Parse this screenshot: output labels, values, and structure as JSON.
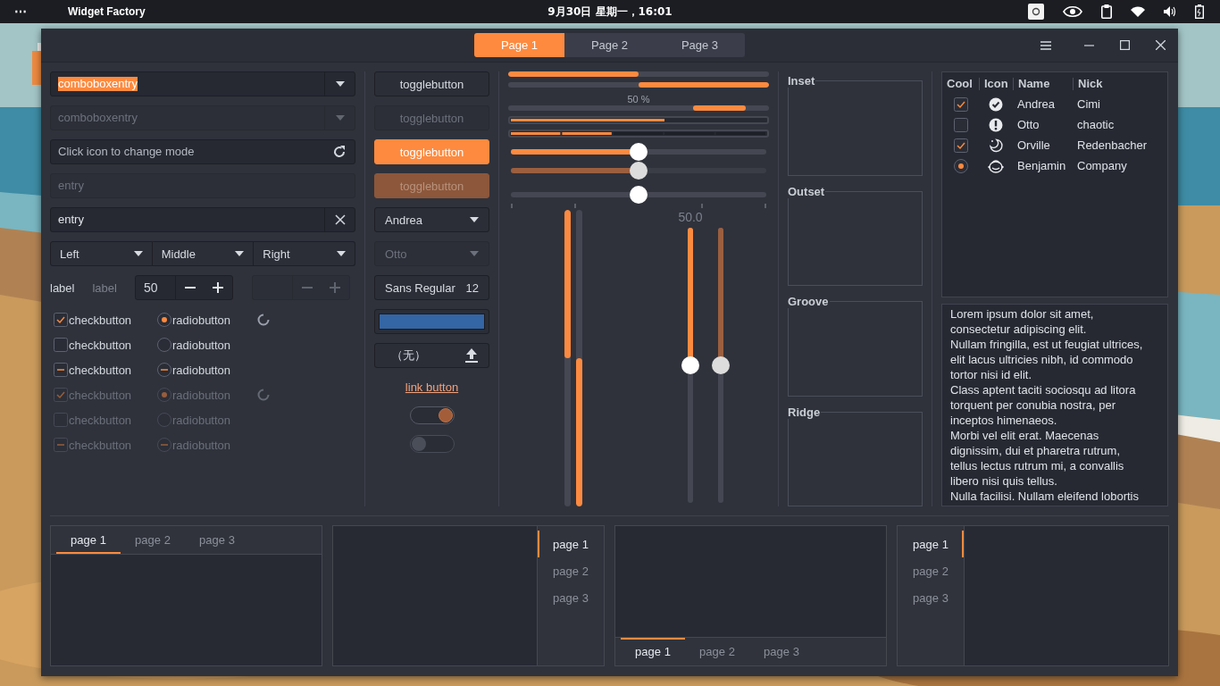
{
  "topbar": {
    "menu": "⋯",
    "app": "Widget Factory",
    "clock": "9月30日 星期一，16:01"
  },
  "header": {
    "tabs": [
      {
        "label": "Page 1",
        "selected": true
      },
      {
        "label": "Page 2",
        "selected": false
      },
      {
        "label": "Page 3",
        "selected": false
      }
    ]
  },
  "combo_entries": [
    {
      "value": "comboboxentry",
      "text_selected": true,
      "disabled": false
    },
    {
      "value": "comboboxentry",
      "text_selected": false,
      "disabled": true
    }
  ],
  "entries": [
    {
      "kind": "mode",
      "placeholder": "Click icon to change mode",
      "disabled": false
    },
    {
      "kind": "plain",
      "value": "entry",
      "disabled": true
    },
    {
      "kind": "clear",
      "value": "entry",
      "disabled": false
    }
  ],
  "linked_combos": [
    {
      "label": "Left"
    },
    {
      "label": "Middle"
    },
    {
      "label": "Right"
    }
  ],
  "labels": [
    {
      "text": "label",
      "disabled": false
    },
    {
      "text": "label",
      "disabled": true
    }
  ],
  "spinbuttons": [
    {
      "value": "50",
      "disabled": false
    },
    {
      "disabled": true
    }
  ],
  "check_rows": [
    {
      "check": {
        "label": "checkbutton",
        "checked": true,
        "inconsistent": false
      },
      "radio": {
        "label": "radiobutton",
        "selected": true,
        "inconsistent": false
      },
      "spinner": true,
      "disabled": false
    },
    {
      "check": {
        "label": "checkbutton",
        "checked": false,
        "inconsistent": false
      },
      "radio": {
        "label": "radiobutton",
        "selected": false,
        "inconsistent": false
      },
      "spinner": false,
      "disabled": false
    },
    {
      "check": {
        "label": "checkbutton",
        "checked": false,
        "inconsistent": true
      },
      "radio": {
        "label": "radiobutton",
        "selected": false,
        "inconsistent": true
      },
      "spinner": false,
      "disabled": false
    },
    {
      "check": {
        "label": "checkbutton",
        "checked": true,
        "inconsistent": false
      },
      "radio": {
        "label": "radiobutton",
        "selected": true,
        "inconsistent": false
      },
      "spinner": true,
      "disabled": true
    },
    {
      "check": {
        "label": "checkbutton",
        "checked": false,
        "inconsistent": false
      },
      "radio": {
        "label": "radiobutton",
        "selected": false,
        "inconsistent": false
      },
      "spinner": false,
      "disabled": true
    },
    {
      "check": {
        "label": "checkbutton",
        "checked": false,
        "inconsistent": true
      },
      "radio": {
        "label": "radiobutton",
        "selected": false,
        "inconsistent": true
      },
      "spinner": false,
      "disabled": true
    }
  ],
  "toggle_buttons": [
    {
      "label": "togglebutton",
      "active": false,
      "disabled": false
    },
    {
      "label": "togglebutton",
      "active": false,
      "disabled": true
    },
    {
      "label": "togglebutton",
      "active": true,
      "disabled": false
    },
    {
      "label": "togglebutton",
      "active": true,
      "disabled": true
    }
  ],
  "combo_boxes": [
    {
      "value": "Andrea",
      "disabled": false
    },
    {
      "value": "Otto",
      "disabled": true
    }
  ],
  "font_button": {
    "family": "Sans Regular",
    "size": "12"
  },
  "color_button": {
    "color": "#3465a4"
  },
  "file_button": {
    "label": "（无）"
  },
  "link_button": {
    "label": "link button"
  },
  "switches": [
    {
      "on": true,
      "disabled": false
    },
    {
      "on": false,
      "disabled": true
    }
  ],
  "progress_bars": [
    {
      "kind": "normal",
      "level": 0.5
    },
    {
      "kind": "inverted",
      "level": 0.5
    },
    {
      "kind": "activity",
      "text": "50 %"
    }
  ],
  "level_bars": [
    {
      "kind": "continuous",
      "level": 0.6
    },
    {
      "kind": "discrete",
      "level": 0.4
    }
  ],
  "scales": [
    {
      "kind": "fill",
      "level": 0.5,
      "disabled": false
    },
    {
      "kind": "fill",
      "level": 0.5,
      "disabled": true
    },
    {
      "kind": "marks",
      "level": 0.5,
      "disabled": false
    }
  ],
  "vertical_progress_bars": [
    {
      "kind": "normal",
      "level": 0.5
    },
    {
      "kind": "inverted",
      "level": 0.5
    }
  ],
  "vertical_scales": [
    {
      "value": "50.0",
      "level": 0.5,
      "disabled": false
    },
    {
      "level": 0.5,
      "disabled": true
    }
  ],
  "frames": [
    {
      "label": "Inset"
    },
    {
      "label": "Outset"
    },
    {
      "label": "Groove"
    },
    {
      "label": "Ridge"
    }
  ],
  "tree": {
    "columns": [
      "Cool",
      "Icon",
      "Name",
      "Nick"
    ],
    "rows": [
      {
        "kind": "check",
        "checked": true,
        "name": "Andrea",
        "nick": "Cimi"
      },
      {
        "kind": "check",
        "checked": false,
        "name": "Otto",
        "nick": "chaotic"
      },
      {
        "kind": "check",
        "checked": true,
        "name": "Orville",
        "nick": "Redenbacher"
      },
      {
        "kind": "radio",
        "checked": true,
        "name": "Benjamin",
        "nick": "Company"
      }
    ]
  },
  "text_view": {
    "paragraphs": [
      "Lorem ipsum dolor sit amet,\nconsectetur adipiscing elit.",
      "Nullam fringilla, est ut feugiat ultrices,\nelit lacus ultricies nibh, id commodo\ntortor nisi id elit.",
      "Class aptent taciti sociosqu ad litora\ntorquent per conubia nostra, per\ninceptos himenaeos.",
      "Morbi vel elit erat. Maecenas\ndignissim, dui et pharetra rutrum,\ntellus lectus rutrum mi, a convallis\nlibero nisi quis tellus.",
      "Nulla facilisi. Nullam eleifend lobortis"
    ]
  },
  "notebooks": [
    {
      "kind": "top",
      "tabs": [
        {
          "label": "page 1",
          "selected": true
        },
        {
          "label": "page 2",
          "selected": false
        },
        {
          "label": "page 3",
          "selected": false
        }
      ]
    },
    {
      "kind": "right",
      "tabs": [
        {
          "label": "page 1",
          "selected": true
        },
        {
          "label": "page 2",
          "selected": false
        },
        {
          "label": "page 3",
          "selected": false
        }
      ]
    },
    {
      "kind": "bottom",
      "tabs": [
        {
          "label": "page 1",
          "selected": true
        },
        {
          "label": "page 2",
          "selected": false
        },
        {
          "label": "page 3",
          "selected": false
        }
      ]
    },
    {
      "kind": "left",
      "tabs": [
        {
          "label": "page 1",
          "selected": true
        },
        {
          "label": "page 2",
          "selected": false
        },
        {
          "label": "page 3",
          "selected": false
        }
      ]
    }
  ]
}
